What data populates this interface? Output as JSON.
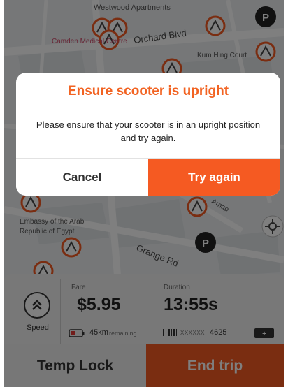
{
  "map": {
    "place_labels": [
      "Westwood Apartments",
      "Camden Medical Centre",
      "Kum Hing Court",
      "Embassy of the Arab",
      "Republic of Egypt"
    ],
    "road_labels": [
      "Orchard Blvd",
      "Grange Rd",
      "Arnap"
    ],
    "parking_label": "P"
  },
  "dialog": {
    "title": "Ensure scooter is upright",
    "message": "Please ensure that your scooter is in an upright position and try again.",
    "cancel_label": "Cancel",
    "retry_label": "Try again"
  },
  "trip": {
    "speed_label": "Speed",
    "fare_label": "Fare",
    "fare_value": "$5.95",
    "duration_label": "Duration",
    "duration_value": "13:55s",
    "range_value": "45km",
    "range_unit": "remaining",
    "scooter_id_mask": "XXXXXX",
    "scooter_id": "4625",
    "temp_lock_label": "Temp Lock",
    "end_trip_label": "End trip"
  },
  "colors": {
    "accent": "#f55a22",
    "title": "#f26322",
    "map_bg": "#eceff1",
    "road": "#ffffff"
  }
}
